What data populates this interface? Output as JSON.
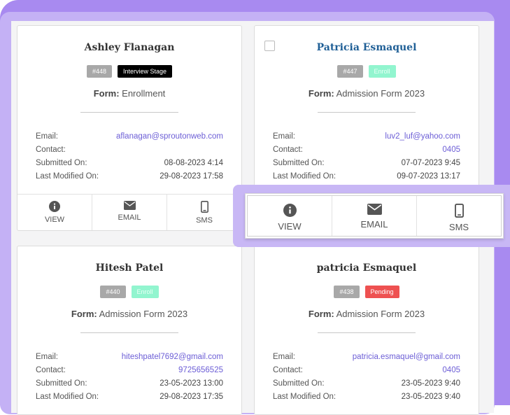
{
  "cards": [
    {
      "name": "Ashley Flanagan",
      "id_badge": "#448",
      "status_badge": "Interview Stage",
      "form_label": "Form:",
      "form_value": "Enrollment",
      "email_label": "Email:",
      "email": "aflanagan@sproutonweb.com",
      "contact_label": "Contact:",
      "contact": "",
      "submitted_label": "Submitted On:",
      "submitted": "08-08-2023 4:14",
      "modified_label": "Last Modified On:",
      "modified": "29-08-2023 17:58"
    },
    {
      "name": "Patricia Esmaquel",
      "id_badge": "#447",
      "status_badge": "Enroll",
      "form_label": "Form:",
      "form_value": "Admission Form 2023",
      "email_label": "Email:",
      "email": "luv2_luf@yahoo.com",
      "contact_label": "Contact:",
      "contact": "0405",
      "submitted_label": "Submitted On:",
      "submitted": "07-07-2023 9:45",
      "modified_label": "Last Modified On:",
      "modified": "09-07-2023 13:17"
    },
    {
      "name": "Hitesh Patel",
      "id_badge": "#440",
      "status_badge": "Enroll",
      "form_label": "Form:",
      "form_value": "Admission Form 2023",
      "email_label": "Email:",
      "email": "hiteshpatel7692@gmail.com",
      "contact_label": "Contact:",
      "contact": "9725656525",
      "submitted_label": "Submitted On:",
      "submitted": "23-05-2023 13:00",
      "modified_label": "Last Modified On:",
      "modified": "29-08-2023 17:35"
    },
    {
      "name": "patricia Esmaquel",
      "id_badge": "#438",
      "status_badge": "Pending",
      "form_label": "Form:",
      "form_value": "Admission Form 2023",
      "email_label": "Email:",
      "email": "patricia.esmaquel@gmail.com",
      "contact_label": "Contact:",
      "contact": "0405",
      "submitted_label": "Submitted On:",
      "submitted": "23-05-2023 9:40",
      "modified_label": "Last Modified On:",
      "modified": "23-05-2023 9:40"
    }
  ],
  "actions": {
    "view": "VIEW",
    "email": "EMAIL",
    "sms": "SMS"
  },
  "colors": {
    "accent_purple": "#a88af0",
    "link": "#6c5ed6",
    "badge_black": "#000000",
    "badge_green": "#92f5cf",
    "badge_red": "#ee5151"
  }
}
